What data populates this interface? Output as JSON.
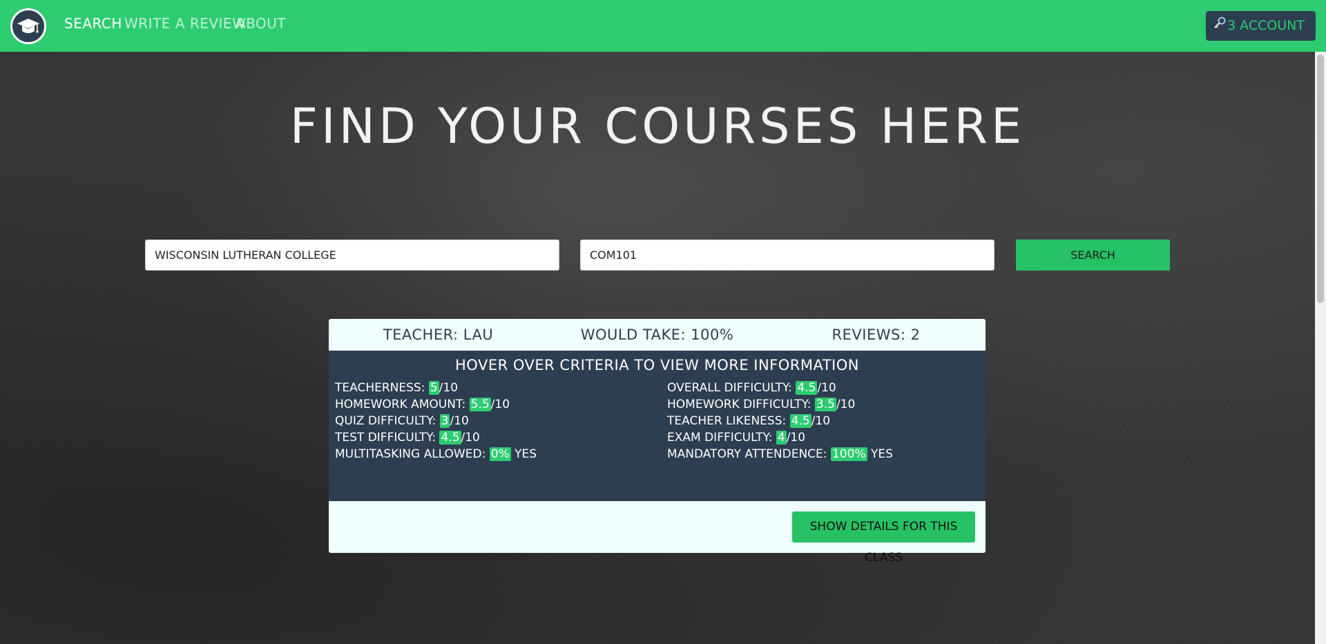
{
  "navbar": {
    "links": [
      "SEARCH",
      "WRITE A REVIEW",
      "ABOUT"
    ],
    "account_label": "3 ACCOUNT",
    "brand_color": "#2ecc71",
    "dark_color": "#2c3e50"
  },
  "hero": {
    "title": "FIND YOUR COURSES HERE"
  },
  "search": {
    "school_value": "WISCONSIN LUTHERAN COLLEGE",
    "course_value": "COM101",
    "button_label": "SEARCH"
  },
  "result": {
    "teacher": "TEACHER: LAU",
    "would_take": "WOULD TAKE: 100%",
    "reviews": "REVIEWS: 2",
    "hover_title": "HOVER OVER CRITERIA TO VIEW MORE INFORMATION",
    "criteria": [
      {
        "label": "TEACHERNESS:",
        "value": "5",
        "suffix": "/10"
      },
      {
        "label": "OVERALL DIFFICULTY:",
        "value": "4.5",
        "suffix": "/10"
      },
      {
        "label": "HOMEWORK AMOUNT:",
        "value": "5.5",
        "suffix": "/10"
      },
      {
        "label": "HOMEWORK DIFFICULTY:",
        "value": "3.5",
        "suffix": "/10"
      },
      {
        "label": "QUIZ DIFFICULTY:",
        "value": "3",
        "suffix": "/10"
      },
      {
        "label": "TEACHER LIKENESS:",
        "value": "4.5",
        "suffix": "/10"
      },
      {
        "label": "TEST DIFFICULTY:",
        "value": "4.5",
        "suffix": "/10"
      },
      {
        "label": "EXAM DIFFICULTY:",
        "value": "4",
        "suffix": "/10"
      },
      {
        "label": "MULTITASKING ALLOWED:",
        "value": "0%",
        "suffix": "YES"
      },
      {
        "label": "MANDATORY ATTENDENCE:",
        "value": "100%",
        "suffix": "YES"
      }
    ],
    "details_button": "SHOW DETAILS FOR THIS CLASS"
  }
}
